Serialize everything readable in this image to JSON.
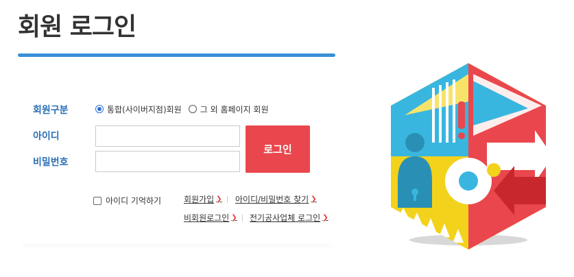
{
  "page": {
    "title": "회원 로그인"
  },
  "form": {
    "member_type_label": "회원구분",
    "options": [
      {
        "label": "통합(사이버지점)회원",
        "checked": true
      },
      {
        "label": "그 외 홈페이지 회원",
        "checked": false
      }
    ],
    "id_label": "아이디",
    "id_value": "",
    "pw_label": "비밀번호",
    "pw_value": "",
    "login_button": "로그인",
    "remember_label": "아이디 기억하기",
    "remember_checked": false
  },
  "links": {
    "join": "회원가입",
    "find": "아이디/비밀번호 찾기",
    "guest": "비회원로그인",
    "corp": "전기공사업체 로그인"
  },
  "icons": {
    "link_arrow": "chevron-right-icon",
    "illustration": "key-illustration-icon"
  },
  "colors": {
    "accent": "#3a8fd8",
    "label": "#2a6eb5",
    "button": "#e9474d"
  }
}
